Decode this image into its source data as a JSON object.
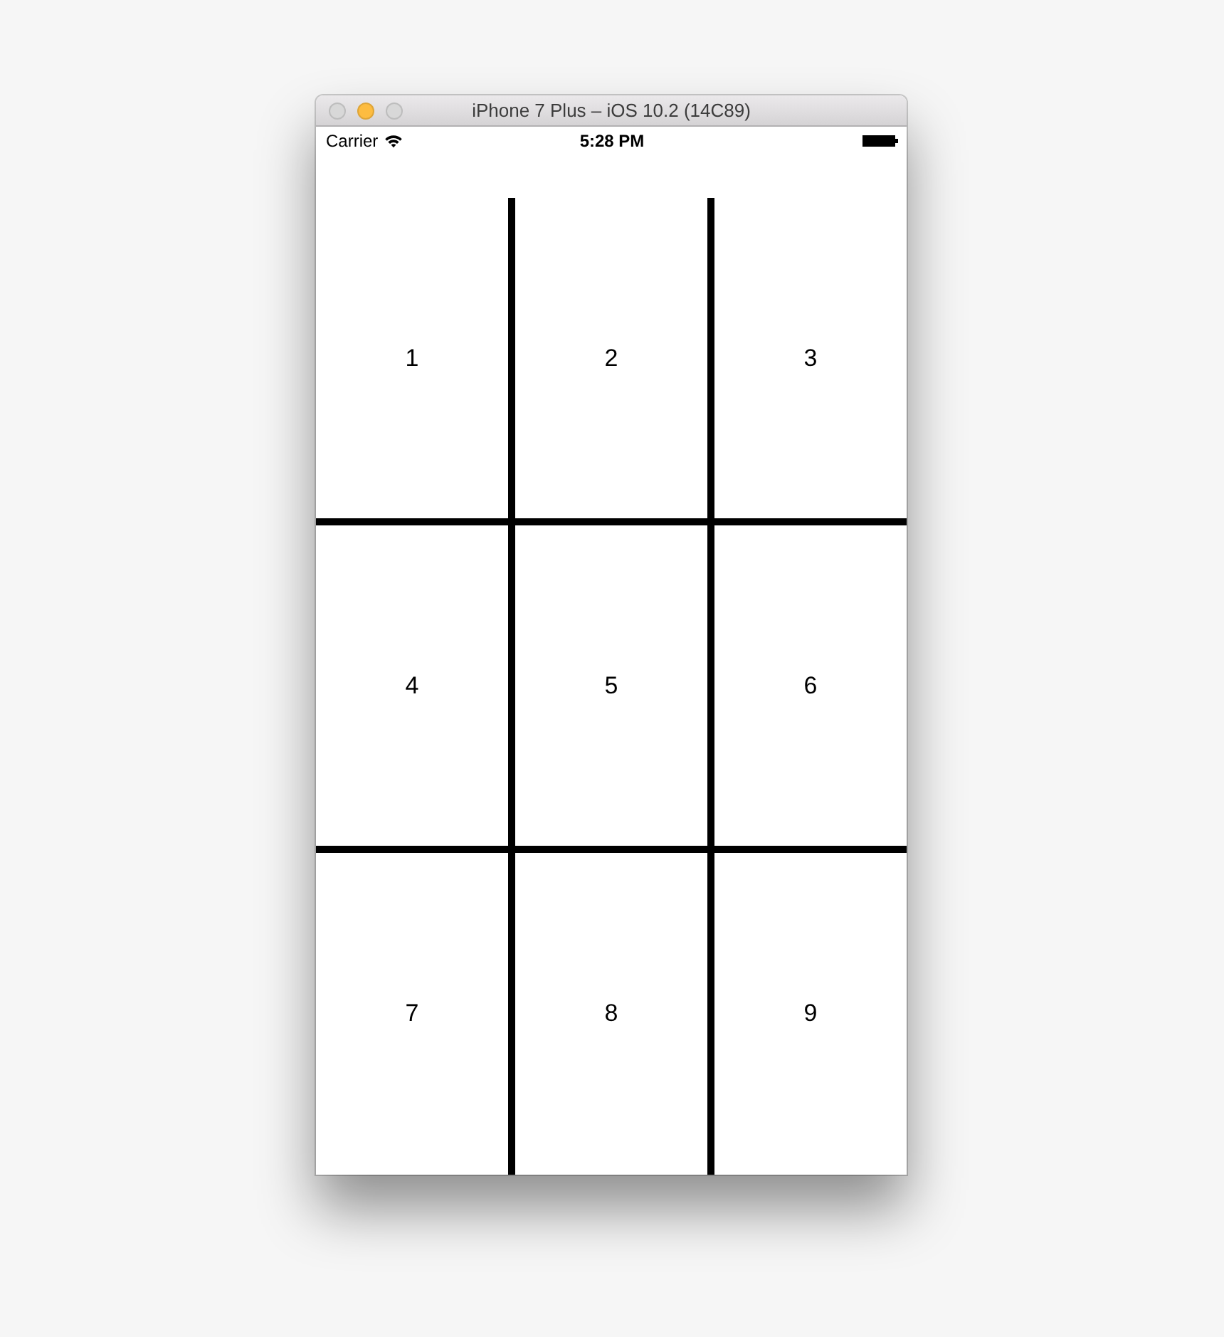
{
  "window": {
    "title": "iPhone 7 Plus – iOS 10.2 (14C89)",
    "traffic_lights": [
      {
        "color": "#d8d8d8"
      },
      {
        "color": "#fdbc40"
      },
      {
        "color": "#d8d8d8"
      }
    ]
  },
  "status_bar": {
    "carrier": "Carrier",
    "time": "5:28 PM"
  },
  "grid": {
    "cells": [
      {
        "label": "1"
      },
      {
        "label": "2"
      },
      {
        "label": "3"
      },
      {
        "label": "4"
      },
      {
        "label": "5"
      },
      {
        "label": "6"
      },
      {
        "label": "7"
      },
      {
        "label": "8"
      },
      {
        "label": "9"
      }
    ]
  }
}
